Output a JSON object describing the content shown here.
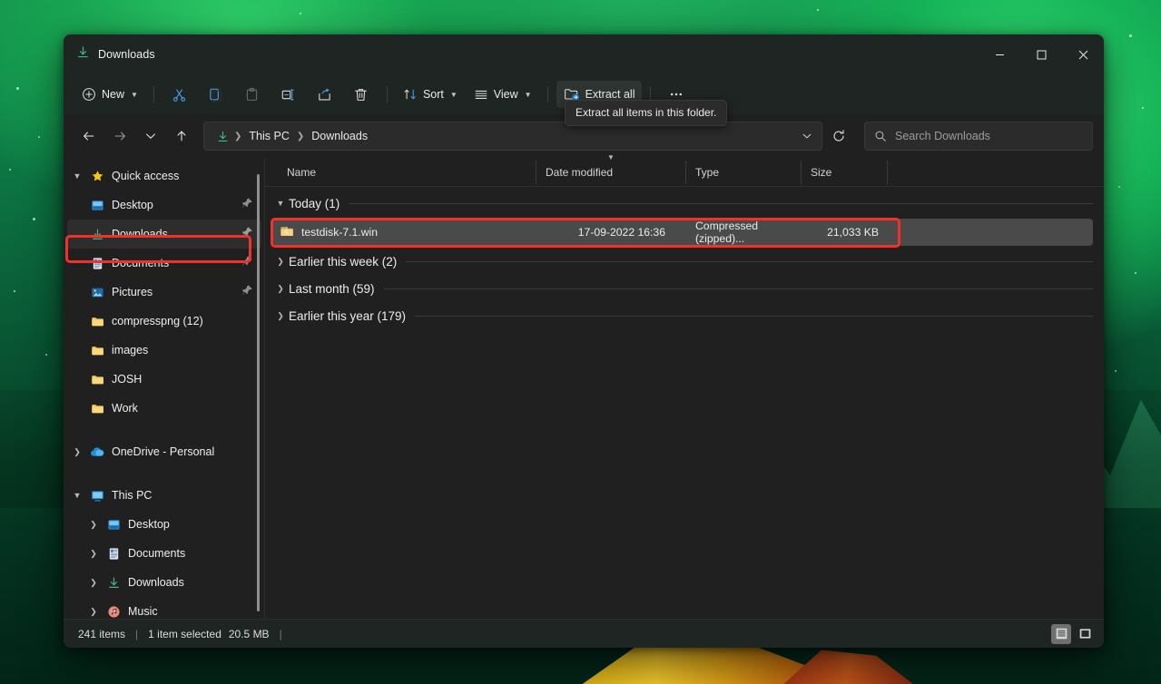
{
  "window": {
    "title": "Downloads",
    "title_icon": "downloads-arrow-icon",
    "minimize_label": "Minimize",
    "maximize_label": "Maximize",
    "close_label": "Close"
  },
  "toolbar": {
    "new_label": "New",
    "cut_label": "Cut",
    "copy_label": "Copy",
    "paste_label": "Paste",
    "rename_label": "Rename",
    "share_label": "Share",
    "delete_label": "Delete",
    "sort_label": "Sort",
    "view_label": "View",
    "extract_all_label": "Extract all",
    "more_label": "See more",
    "tooltip": "Extract all items in this folder."
  },
  "address": {
    "back_label": "Back",
    "forward_label": "Forward",
    "recent_label": "Recent locations",
    "up_label": "Up to This PC",
    "breadcrumbs": [
      "This PC",
      "Downloads"
    ],
    "crumb_icon": "downloads-arrow-icon",
    "dropdown_label": "Previous locations",
    "refresh_label": "Refresh"
  },
  "search": {
    "placeholder": "Search Downloads",
    "icon": "search-icon"
  },
  "sidebar": {
    "sections": [
      {
        "name": "quick-access",
        "label": "Quick access",
        "icon": "star-icon",
        "expanded": true,
        "items": [
          {
            "label": "Desktop",
            "icon": "desktop-icon",
            "pinned": true,
            "selected": false,
            "indent": true
          },
          {
            "label": "Downloads",
            "icon": "downloads-icon",
            "pinned": true,
            "selected": true,
            "indent": true
          },
          {
            "label": "Documents",
            "icon": "documents-icon",
            "pinned": true,
            "selected": false,
            "indent": true
          },
          {
            "label": "Pictures",
            "icon": "pictures-icon",
            "pinned": true,
            "selected": false,
            "indent": true
          },
          {
            "label": "compresspng (12)",
            "icon": "folder-icon",
            "pinned": false,
            "selected": false,
            "indent": true
          },
          {
            "label": "images",
            "icon": "folder-icon",
            "pinned": false,
            "selected": false,
            "indent": true
          },
          {
            "label": "JOSH",
            "icon": "folder-icon",
            "pinned": false,
            "selected": false,
            "indent": true
          },
          {
            "label": "Work",
            "icon": "folder-icon",
            "pinned": false,
            "selected": false,
            "indent": true
          }
        ]
      },
      {
        "name": "onedrive",
        "label": "OneDrive - Personal",
        "icon": "cloud-icon",
        "expanded": false,
        "items": []
      },
      {
        "name": "this-pc",
        "label": "This PC",
        "icon": "monitor-icon",
        "expanded": true,
        "items": [
          {
            "label": "Desktop",
            "icon": "desktop-icon",
            "pinned": false,
            "selected": false,
            "indent": true,
            "twisty": true
          },
          {
            "label": "Documents",
            "icon": "documents-icon",
            "pinned": false,
            "selected": false,
            "indent": true,
            "twisty": true
          },
          {
            "label": "Downloads",
            "icon": "downloads-icon",
            "pinned": false,
            "selected": false,
            "indent": true,
            "twisty": true
          },
          {
            "label": "Music",
            "icon": "music-icon",
            "pinned": false,
            "selected": false,
            "indent": true,
            "twisty": true
          }
        ]
      }
    ]
  },
  "filelist": {
    "columns": [
      {
        "key": "name",
        "label": "Name",
        "sorted": false
      },
      {
        "key": "date",
        "label": "Date modified",
        "sorted": true
      },
      {
        "key": "type",
        "label": "Type",
        "sorted": false
      },
      {
        "key": "size",
        "label": "Size",
        "sorted": false
      }
    ],
    "groups": [
      {
        "label": "Today (1)",
        "expanded": true,
        "rows": [
          {
            "name": "testdisk-7.1.win",
            "date": "17-09-2022 16:36",
            "type": "Compressed (zipped)...",
            "size": "21,033 KB",
            "icon": "zip-folder-icon",
            "selected": true
          }
        ]
      },
      {
        "label": "Earlier this week (2)",
        "expanded": false,
        "rows": []
      },
      {
        "label": "Last month (59)",
        "expanded": false,
        "rows": []
      },
      {
        "label": "Earlier this year (179)",
        "expanded": false,
        "rows": []
      }
    ]
  },
  "statusbar": {
    "item_count": "241 items",
    "selection": "1 item selected",
    "selection_size": "20.5 MB",
    "details_view_label": "Details view",
    "large_icons_view_label": "Large icons view"
  },
  "colors": {
    "accent_highlight": "#f0322a",
    "window_bg": "#202020",
    "chrome_bg": "#1f2523",
    "selection_bg": "#4a4a4a",
    "folder_yellow": "#f6c95b",
    "download_green": "#3bba87",
    "icon_blue": "#4aa3e8"
  }
}
